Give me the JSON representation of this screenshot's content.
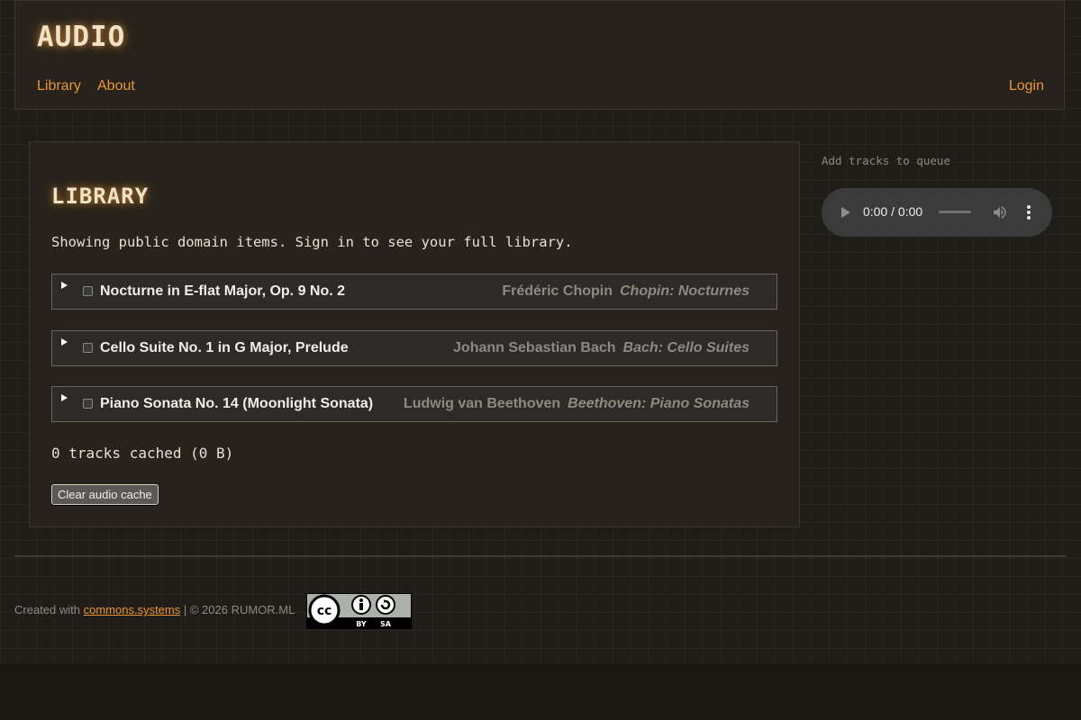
{
  "header": {
    "title": "AUDIO",
    "nav": [
      {
        "label": "Library"
      },
      {
        "label": "About"
      }
    ],
    "login_label": "Login"
  },
  "library": {
    "heading": "LIBRARY",
    "intro": "Showing public domain items. Sign in to see your full library.",
    "tracks": [
      {
        "title": "Nocturne in E-flat Major, Op. 9 No. 2",
        "artist": "Frédéric Chopin",
        "album": "Chopin: Nocturnes",
        "checked": false
      },
      {
        "title": "Cello Suite No. 1 in G Major, Prelude",
        "artist": "Johann Sebastian Bach",
        "album": "Bach: Cello Suites",
        "checked": false
      },
      {
        "title": "Piano Sonata No. 14 (Moonlight Sonata)",
        "artist": "Ludwig van Beethoven",
        "album": "Beethoven: Piano Sonatas",
        "checked": false
      }
    ],
    "cache_status": "0 tracks cached (0 B)",
    "clear_cache_label": "Clear audio cache"
  },
  "sidebar": {
    "queue_hint": "Add tracks to queue",
    "player": {
      "time": "0:00 / 0:00",
      "icons": [
        "play-icon",
        "volume-icon",
        "more-options-icon"
      ]
    }
  },
  "footer": {
    "created_with": "Created with",
    "link_label": "commons.systems",
    "copyright": "| © 2026 RUMOR.ML",
    "license_badge": {
      "cc": "cc",
      "by": "BY",
      "sa": "SA"
    }
  },
  "colors": {
    "accent": "#e8953a",
    "background": "#201d18",
    "panel": "#27231c",
    "heading_glow": "#e6963c"
  }
}
